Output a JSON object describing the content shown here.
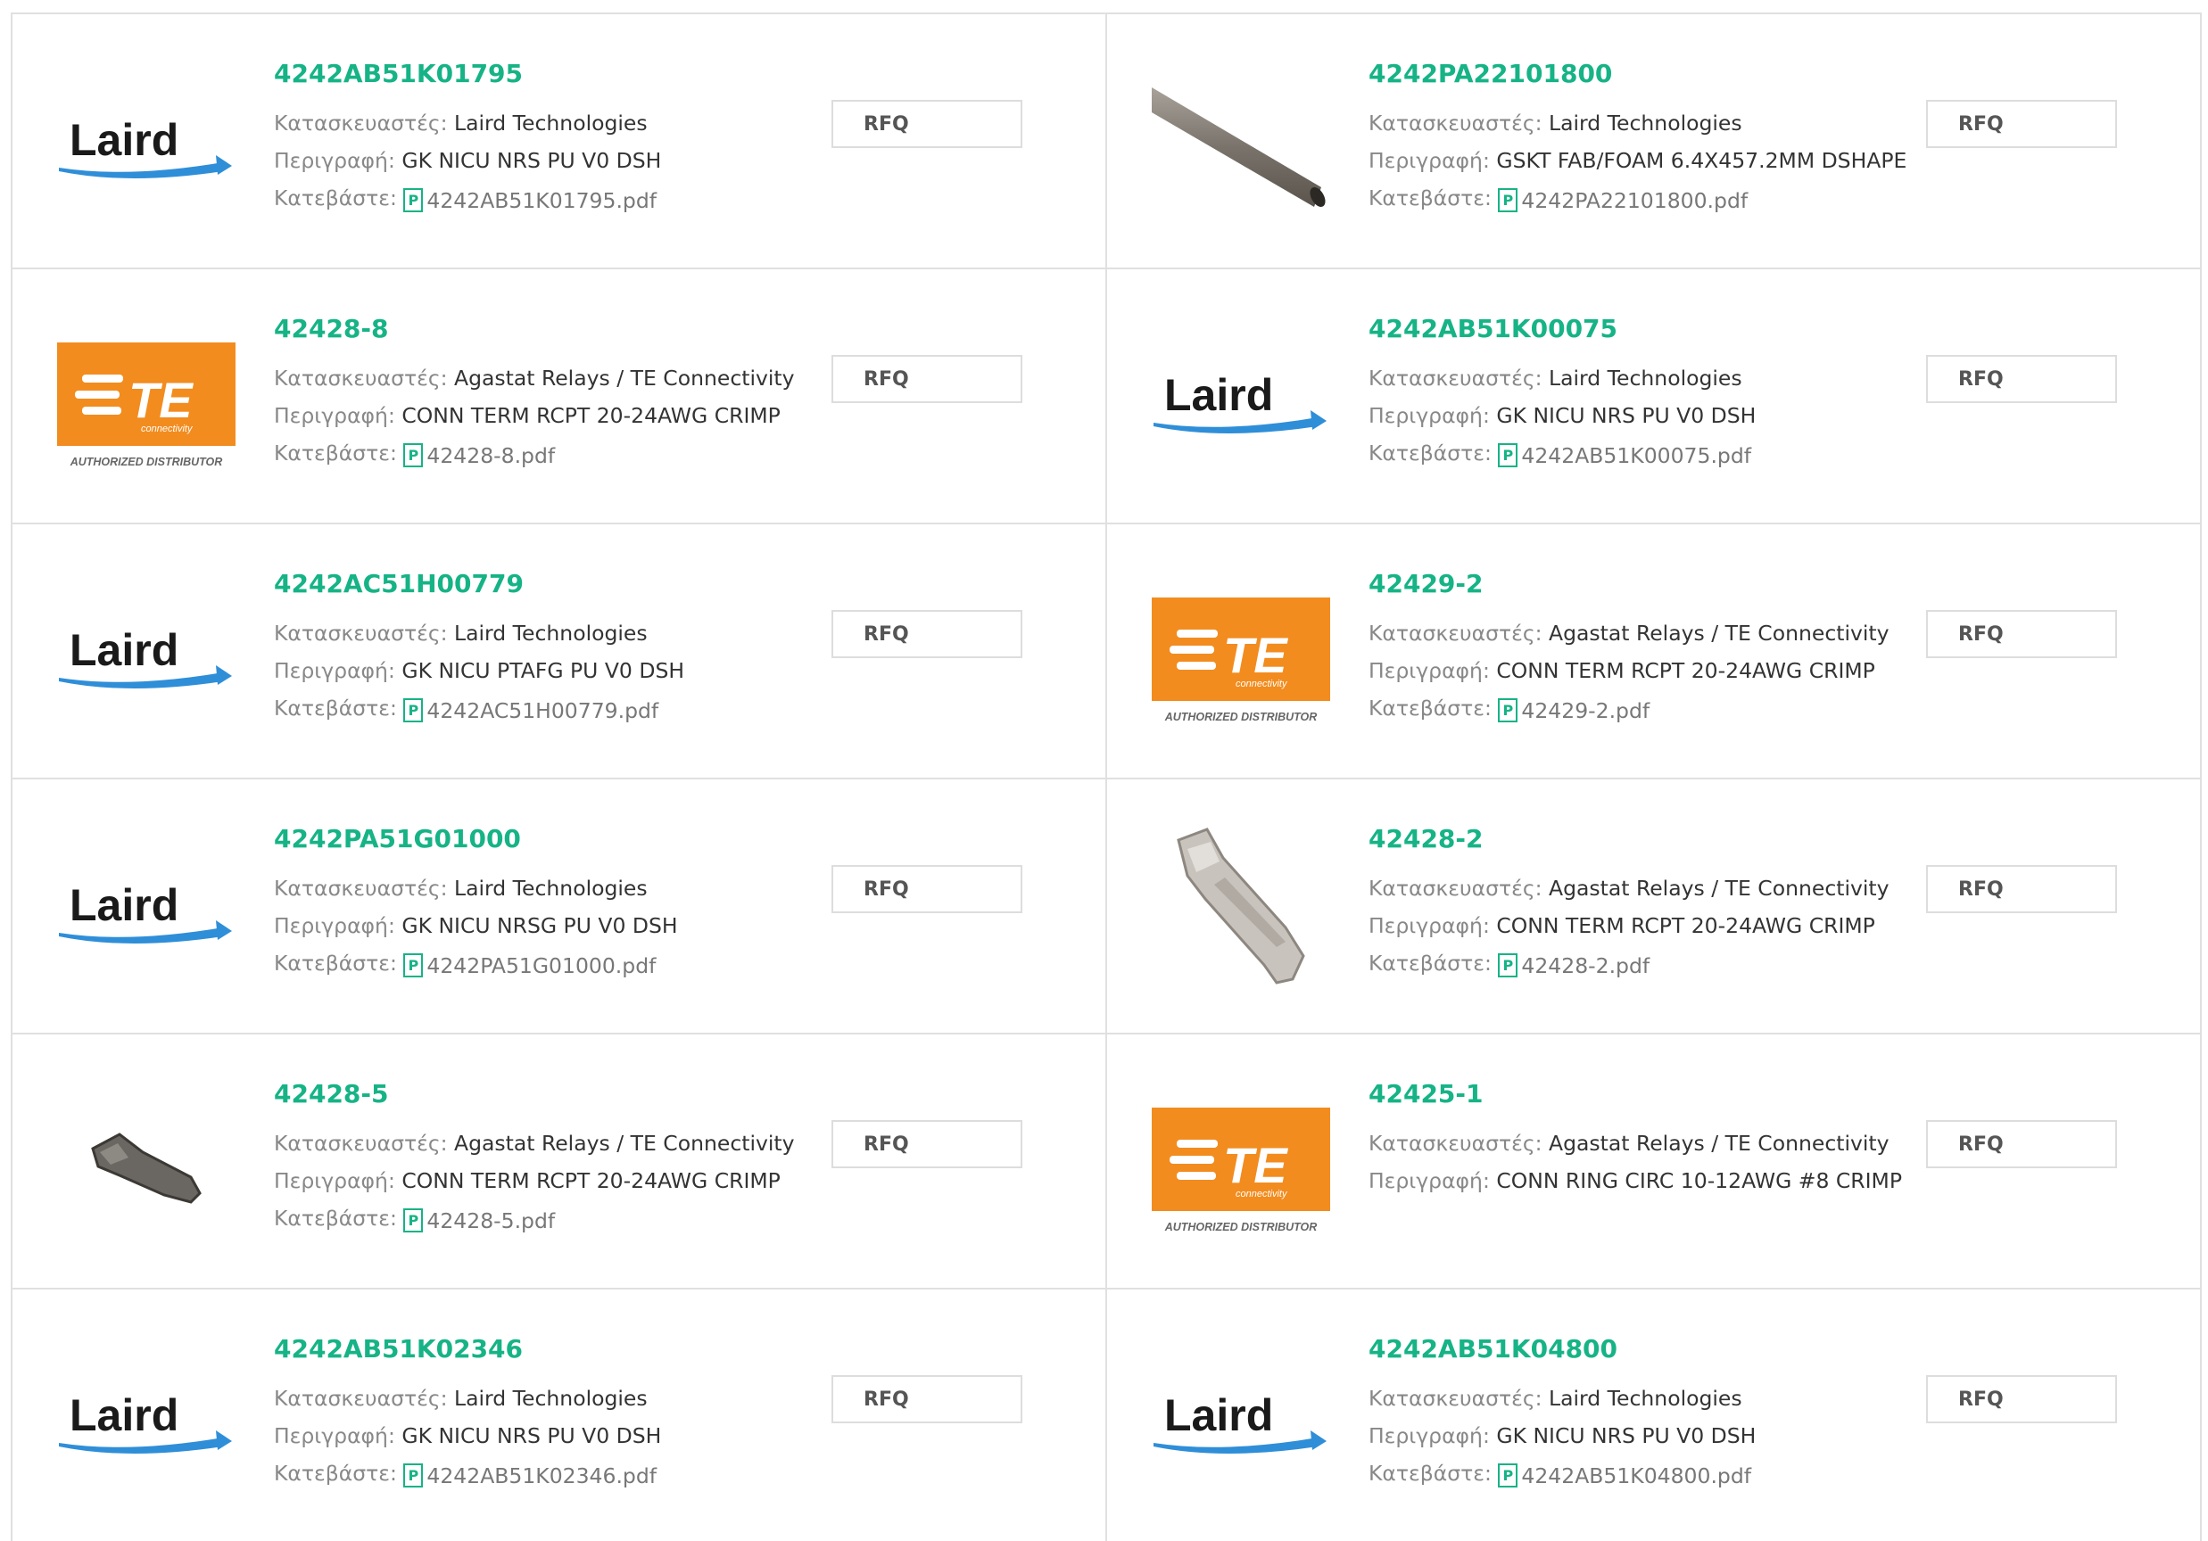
{
  "labels": {
    "manufacturer": "Κατασκευαστές:",
    "description": "Περιγραφή:",
    "download": "Κατεβάστε:",
    "rfq": "RFQ"
  },
  "te_logo": {
    "brand": "TE",
    "sub": "connectivity",
    "badge": "AUTHORIZED DISTRIBUTOR",
    "color": "#f28c1f"
  },
  "laird_logo": {
    "brand": "Laird",
    "color": "#1a1a1a",
    "swoosh": "#2f8ed8"
  },
  "products": [
    {
      "pn": "4242AB51K01795",
      "manufacturer": "Laird Technologies",
      "description": "GK NICU NRS PU V0 DSH",
      "pdf": "4242AB51K01795.pdf",
      "image": "laird-logo"
    },
    {
      "pn": "4242PA22101800",
      "manufacturer": "Laird Technologies",
      "description": "GSKT FAB/FOAM 6.4X457.2MM DSHAPE",
      "pdf": "4242PA22101800.pdf",
      "image": "gasket-photo"
    },
    {
      "pn": "42428-8",
      "manufacturer": "Agastat Relays / TE Connectivity",
      "description": "CONN TERM RCPT 20-24AWG CRIMP",
      "pdf": "42428-8.pdf",
      "image": "te-logo"
    },
    {
      "pn": "4242AB51K00075",
      "manufacturer": "Laird Technologies",
      "description": "GK NICU NRS PU V0 DSH",
      "pdf": "4242AB51K00075.pdf",
      "image": "laird-logo"
    },
    {
      "pn": "4242AC51H00779",
      "manufacturer": "Laird Technologies",
      "description": "GK NICU PTAFG PU V0 DSH",
      "pdf": "4242AC51H00779.pdf",
      "image": "laird-logo"
    },
    {
      "pn": "42429-2",
      "manufacturer": "Agastat Relays / TE Connectivity",
      "description": "CONN TERM RCPT 20-24AWG CRIMP",
      "pdf": "42429-2.pdf",
      "image": "te-logo"
    },
    {
      "pn": "4242PA51G01000",
      "manufacturer": "Laird Technologies",
      "description": "GK NICU NRSG PU V0 DSH",
      "pdf": "4242PA51G01000.pdf",
      "image": "laird-logo"
    },
    {
      "pn": "42428-2",
      "manufacturer": "Agastat Relays / TE Connectivity",
      "description": "CONN TERM RCPT 20-24AWG CRIMP",
      "pdf": "42428-2.pdf",
      "image": "terminal-photo-light"
    },
    {
      "pn": "42428-5",
      "manufacturer": "Agastat Relays / TE Connectivity",
      "description": "CONN TERM RCPT 20-24AWG CRIMP",
      "pdf": "42428-5.pdf",
      "image": "terminal-photo-dark"
    },
    {
      "pn": "42425-1",
      "manufacturer": "Agastat Relays / TE Connectivity",
      "description": "CONN RING CIRC 10-12AWG #8 CRIMP",
      "pdf": null,
      "image": "te-logo"
    },
    {
      "pn": "4242AB51K02346",
      "manufacturer": "Laird Technologies",
      "description": "GK NICU NRS PU V0 DSH",
      "pdf": "4242AB51K02346.pdf",
      "image": "laird-logo"
    },
    {
      "pn": "4242AB51K04800",
      "manufacturer": "Laird Technologies",
      "description": "GK NICU NRS PU V0 DSH",
      "pdf": "4242AB51K04800.pdf",
      "image": "laird-logo"
    }
  ]
}
